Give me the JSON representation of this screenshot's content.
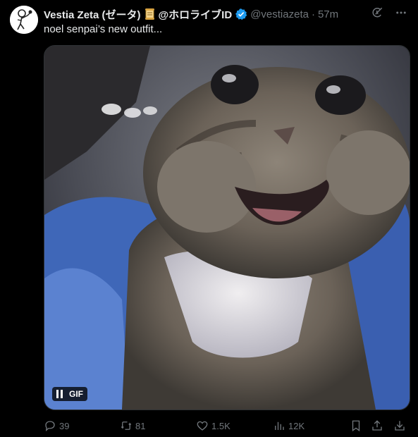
{
  "tweet": {
    "display_name": "Vestia Zeta (ゼータ)",
    "org_label": "@ホロライブID",
    "handle": "@vestiazeta",
    "separator": "·",
    "time": "57m",
    "text": "noel senpai’s new outfit...",
    "media": {
      "badge": "GIF",
      "icons": [
        "pause-icon"
      ]
    },
    "stats": {
      "replies": "39",
      "reposts": "81",
      "likes": "1.5K",
      "views": "12K"
    },
    "icons": [
      "grok-icon",
      "more-icon",
      "reply-icon",
      "repost-icon",
      "like-icon",
      "views-icon",
      "bookmark-icon",
      "share-icon",
      "download-icon",
      "verified-icon",
      "scroll-icon"
    ]
  },
  "colors": {
    "background": "#000000",
    "text": "#e7e9ea",
    "muted": "#71767b",
    "verified": "#1d9bf0"
  }
}
